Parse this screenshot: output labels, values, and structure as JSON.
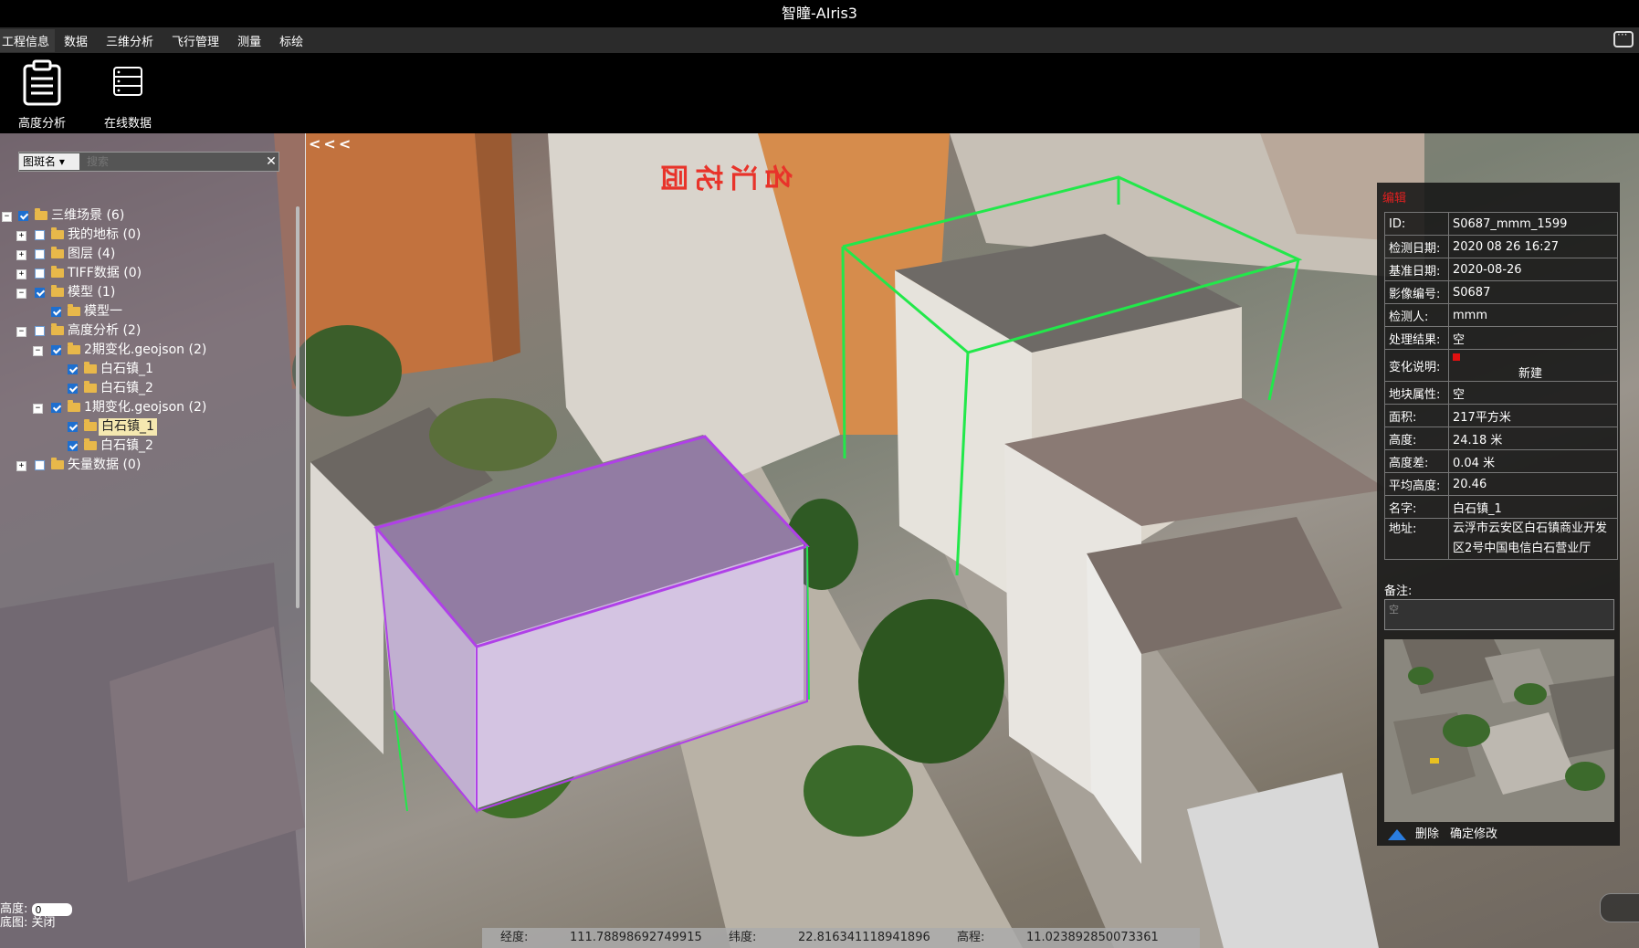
{
  "app": {
    "title": "智瞳-AIris3"
  },
  "menu": {
    "items": [
      "工程信息",
      "数据",
      "三维分析",
      "飞行管理",
      "测量",
      "标绘"
    ],
    "active_index": 0
  },
  "toolbar": {
    "buttons": [
      {
        "label": "高度分析",
        "icon": "clipboard-icon"
      },
      {
        "label": "在线数据",
        "icon": "server-icon"
      }
    ]
  },
  "layer_panel": {
    "search": {
      "select_value": "图斑名",
      "placeholder": "搜索"
    },
    "tree": [
      {
        "label": "三维场景 (6)",
        "toggle": "−",
        "checked": true
      },
      {
        "label": "我的地标 (0)",
        "toggle": "+",
        "checked": false
      },
      {
        "label": "图层 (4)",
        "toggle": "+",
        "checked": false
      },
      {
        "label": "TIFF数据 (0)",
        "toggle": "+",
        "checked": false
      },
      {
        "label": "模型 (1)",
        "toggle": "−",
        "checked": true
      },
      {
        "label": "模型一",
        "toggle": "",
        "checked": true
      },
      {
        "label": "高度分析 (2)",
        "toggle": "−",
        "checked": false
      },
      {
        "label": "2期变化.geojson (2)",
        "toggle": "−",
        "checked": true
      },
      {
        "label": "白石镇_1",
        "toggle": "",
        "checked": true
      },
      {
        "label": "白石镇_2",
        "toggle": "",
        "checked": true
      },
      {
        "label": "1期变化.geojson (2)",
        "toggle": "−",
        "checked": true
      },
      {
        "label": "白石镇_1",
        "toggle": "",
        "checked": true,
        "selected": true
      },
      {
        "label": "白石镇_2",
        "toggle": "",
        "checked": true
      },
      {
        "label": "矢量数据 (0)",
        "toggle": "+",
        "checked": false
      }
    ],
    "height_label": "高度:",
    "height_value": "0",
    "basemap_label": "底图:",
    "basemap_value": "关闭"
  },
  "map": {
    "collapse_label": "<<<",
    "building_sign": "名汇花园"
  },
  "coords": {
    "lon_label": "经度:",
    "lon_value": "111.78898692749915",
    "lat_label": "纬度:",
    "lat_value": "22.816341118941896",
    "alt_label": "高程:",
    "alt_value": "11.023892850073361"
  },
  "info_panel": {
    "title": "编辑",
    "fields": [
      {
        "key": "ID:",
        "value": "S0687_mmm_1599"
      },
      {
        "key": "检测日期:",
        "value": "2020 08 26 16:27"
      },
      {
        "key": "基准日期:",
        "value": "2020-08-26"
      },
      {
        "key": "影像编号:",
        "value": "S0687"
      },
      {
        "key": "检测人:",
        "value": "mmm"
      },
      {
        "key": "处理结果:",
        "value": "空"
      },
      {
        "key": "变化说明:",
        "value": "新建"
      },
      {
        "key": "地块属性:",
        "value": "空"
      },
      {
        "key": "面积:",
        "value": "217平方米"
      },
      {
        "key": "高度:",
        "value": "24.18 米"
      },
      {
        "key": "高度差:",
        "value": "0.04 米"
      },
      {
        "key": "平均高度:",
        "value": "20.46"
      },
      {
        "key": "名字:",
        "value": "白石镇_1"
      },
      {
        "key": "地址:",
        "value": "云浮市云安区白石镇商业开发区2号中国电信白石营业厅"
      }
    ],
    "remark_label": "备注:",
    "remark_value": "空",
    "delete_label": "删除",
    "confirm_label": "确定修改",
    "colors": {
      "title": "#e02020",
      "status_square": "#e01010",
      "accent": "#2a7de0"
    }
  }
}
